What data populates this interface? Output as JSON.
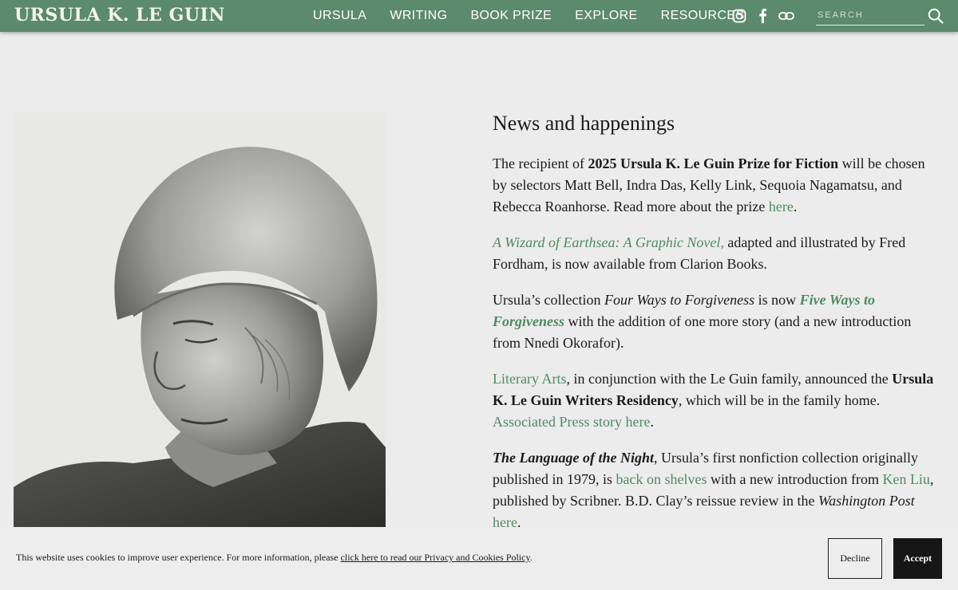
{
  "header": {
    "logo": "URSULA K. LE GUIN",
    "nav": [
      {
        "label": "URSULA"
      },
      {
        "label": "WRITING"
      },
      {
        "label": "BOOK PRIZE"
      },
      {
        "label": "EXPLORE"
      },
      {
        "label": "RESOURCES"
      }
    ],
    "social_icons": [
      "instagram-icon",
      "facebook-icon",
      "link-icon"
    ],
    "search": {
      "placeholder": "SEARCH",
      "value": "",
      "icon": "search-icon"
    },
    "bg_color": "#5b8a6c"
  },
  "main": {
    "heading": "News and happenings",
    "portrait_alt": "Ursula K. Le Guin",
    "news": [
      {
        "t1": "The recipient of ",
        "b1": "2025 Ursula K. Le Guin Prize for Fiction",
        "t2": " will be chosen by selectors Matt Bell, Indra Das, Kelly Link, Sequoia Nagamatsu, and Rebecca Roanhorse. Read more about the prize ",
        "link": "here",
        "t3": "."
      },
      {
        "link": "A Wizard of Earthsea: A Graphic Novel,",
        "t1": " adapted and illustrated by Fred Fordham, is now available from Clarion Books."
      },
      {
        "t1": "Ursula’s collection ",
        "i1": "Four Ways to Forgiveness",
        "t2": " is now ",
        "link": "Five Ways to Forgiveness",
        "t3": " with the addition of one more story (and a new introduction from Nnedi Okorafor)."
      },
      {
        "link1": "Literary Arts",
        "t1": ", in conjunction with the Le Guin family, announced the ",
        "b1": "Ursula K. Le Guin Writers Residency",
        "t2": ", which will be in the family home. ",
        "link2": "Associated Press story here",
        "t3": "."
      },
      {
        "bi1": "The Language of the Night",
        "t1": ", Ursula’s first nonfiction collection originally published in 1979, is ",
        "link1": "back on shelves",
        "t2": " with a new introduction from ",
        "link2": "Ken Liu",
        "t3": ", published by Scribner. B.D. Clay’s reissue review in the ",
        "i1": "Washington Post",
        "t4": " ",
        "link3": "here",
        "t5": "."
      }
    ],
    "link_color": "#4f8a63"
  },
  "cookie_banner": {
    "text": "This website uses cookies to improve user experience. For more information, please ",
    "link": "click here to read our Privacy and Cookies Policy",
    "text_end": ".",
    "decline_label": "Decline",
    "accept_label": "Accept"
  }
}
